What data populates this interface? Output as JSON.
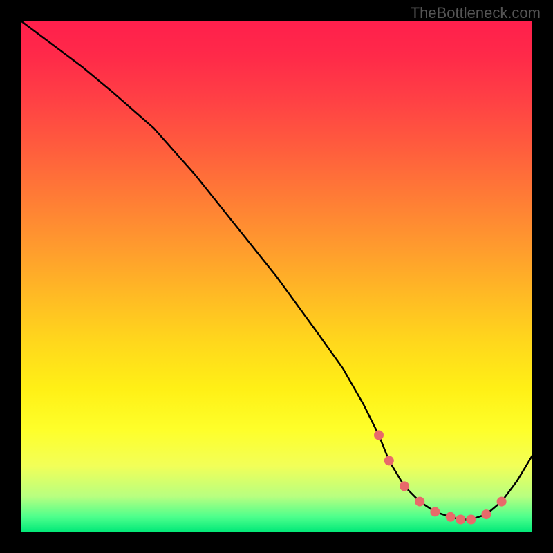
{
  "watermark": "TheBottleneck.com",
  "chart_data": {
    "type": "line",
    "title": "",
    "xlabel": "",
    "ylabel": "",
    "xlim": [
      0,
      100
    ],
    "ylim": [
      0,
      100
    ],
    "series": [
      {
        "name": "curve",
        "x": [
          0,
          4,
          8,
          12,
          18,
          26,
          34,
          42,
          50,
          58,
          63,
          67,
          70,
          72,
          75,
          78,
          81,
          84,
          86,
          88,
          91,
          94,
          97,
          100
        ],
        "y": [
          100,
          97,
          94,
          91,
          86,
          79,
          70,
          60,
          50,
          39,
          32,
          25,
          19,
          14,
          9,
          6,
          4,
          3,
          2.5,
          2.5,
          3.5,
          6,
          10,
          15
        ]
      }
    ],
    "markers": {
      "name": "highlight-dots",
      "color": "#e86a6a",
      "points": [
        {
          "x": 70,
          "y": 19
        },
        {
          "x": 72,
          "y": 14
        },
        {
          "x": 75,
          "y": 9
        },
        {
          "x": 78,
          "y": 6
        },
        {
          "x": 81,
          "y": 4
        },
        {
          "x": 84,
          "y": 3
        },
        {
          "x": 86,
          "y": 2.5
        },
        {
          "x": 88,
          "y": 2.5
        },
        {
          "x": 91,
          "y": 3.5
        },
        {
          "x": 94,
          "y": 6
        }
      ]
    },
    "gradient_stops": [
      {
        "pos": 0,
        "color": "#ff1f4c"
      },
      {
        "pos": 50,
        "color": "#ffd020"
      },
      {
        "pos": 80,
        "color": "#feff2a"
      },
      {
        "pos": 100,
        "color": "#00e878"
      }
    ]
  }
}
